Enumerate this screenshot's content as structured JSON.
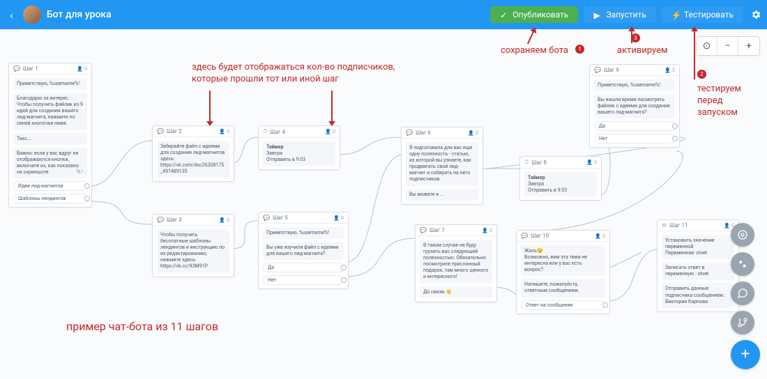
{
  "header": {
    "title": "Бот для урока",
    "publish": "Опубликовать",
    "run": "Запустить",
    "test": "Тестировать"
  },
  "annotations": {
    "subscribers": "здесь будет отображаться кол-во подписчиков,\nкоторые прошли тот или иной шаг",
    "save": "сохраняем бота",
    "activate": "активируем",
    "testing": "тестируем\nперед\nзапуском",
    "example": "пример чат-бота из 11 шагов",
    "b1": "1",
    "b2": "2",
    "b3": "3"
  },
  "steps": {
    "s1": {
      "title": "Шаг 1",
      "count": "0",
      "m1": "Приветствую, %username%!",
      "m2": "Благодарю за интерес. Чтобы получить файлик из 9 идей для создания вашего лид-магнита, нажмите по синей кнопочке ниже.",
      "m3": "Такс...",
      "m4": "Важно: если у вас вдруг не отображаются кнопки, включите их, как показано на скриншоте.",
      "m4tag": "1",
      "b1": "Идеи лид-магнитов",
      "b2": "Шаблоны лендингов"
    },
    "s2": {
      "title": "Шаг 2",
      "count": "0",
      "m1": "Забирайте файл с идеями для создания лид-магнитов здесь: https://vk.com/doc26308175_491489135"
    },
    "s3": {
      "title": "Шаг 3",
      "count": "0",
      "m1": "Чтобы получить бесплатные шаблоны лендингов и инструкцию по их редактированию, нажмите здесь: https://vk.cc/93M91P"
    },
    "s4": {
      "title": "Шаг 4",
      "count": "0",
      "t1": "Таймер",
      "t2": "Завтра",
      "t3": "Отправить в 9:03"
    },
    "s5": {
      "title": "Шаг 5",
      "count": "0",
      "m1": "Приветствую, %username%!",
      "m2": "Вы уже изучили файл с идеями для вашего лид-магнита?",
      "b1": "Да",
      "b2": "Нет"
    },
    "s6": {
      "title": "Шаг 6",
      "count": "0",
      "m1": "Я подготовила для вас еще одну полезность - статью, из которой вы узнаете, как продвигать свой лид-магнит и собирать на него подписчиков.",
      "m2": "Вы можете и ..."
    },
    "s7": {
      "title": "Шаг 7",
      "count": "0",
      "m1": "В таком случае не буду грузить вас следующей полезностью. Обязательно посмотрите присланный подарок, там много ценного и интересного!",
      "m2": "До связи.👋"
    },
    "s8": {
      "title": "Шаг 8",
      "count": "0",
      "t1": "Таймер",
      "t2": "Завтра",
      "t3": "Отправить в 9:03"
    },
    "s9": {
      "title": "Шаг 9",
      "count": "0",
      "m1": "Приветствую, %username%!",
      "m2": "Вы нашли время посмотреть файлик с идеями для создания вашего лид-магнита?",
      "b1": "Да",
      "b2": "Нет"
    },
    "s10": {
      "title": "Шаг 10",
      "count": "0",
      "m1": "Жаль😔\nВозможно, вам эта тема не интересна или у вас есть вопрос?",
      "m2": "Напишите, пожалуйста, ответным сообщением.",
      "b1": "Ответ на сообщение"
    },
    "s11": {
      "title": "Шаг 11",
      "count": "0",
      "m1": "Установить значение переменной\nПеременная: otvet",
      "m2": "Записать ответ в переменную : otvet",
      "m3": "Отправить данные подписчика сообщением :\nВиктория Карпова"
    }
  }
}
